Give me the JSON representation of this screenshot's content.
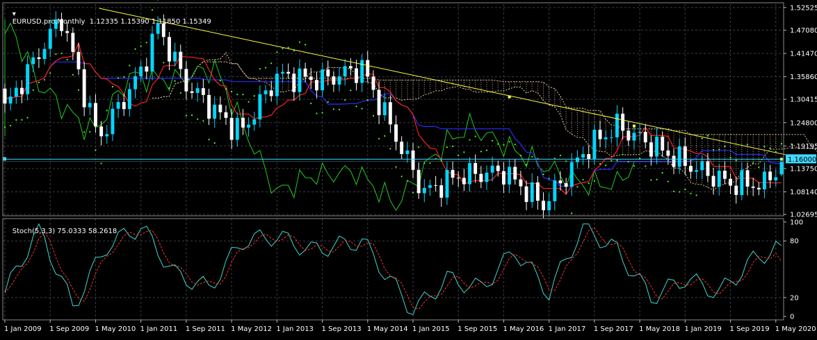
{
  "header": {
    "symbol_line": "EURUSD.pro,Monthly  1.12335 1.15390 1.11850 1.15349",
    "stoch_line": "Stoch(5,3,3) 75.0333 58.2618"
  },
  "colors": {
    "background": "#000000",
    "grid": "#3a3f46",
    "bull_candle": "#00d7ff",
    "bear_candle": "#ffffff",
    "tenkan": "#ff2020",
    "kijun": "#2b2bff",
    "chikou": "#22cc22",
    "cloud": "#e8c9a0",
    "sar": "#55ff22",
    "trendline": "#ffff40",
    "hline": "#40d8ff",
    "stoch_main": "#40d8d0",
    "stoch_signal": "#ff3030"
  },
  "chart_data": [
    {
      "type": "candlestick",
      "symbol": "EURUSD.pro",
      "timeframe": "Monthly",
      "ohlc_last": {
        "open": 1.12335,
        "high": 1.1539,
        "low": 1.1185,
        "close": 1.15349
      },
      "ylim": [
        1.027,
        1.53
      ],
      "y_ticks": [
        "1.52525",
        "1.47080",
        "1.41470",
        "1.35860",
        "1.30415",
        "1.24800",
        "1.19195",
        "1.13750",
        "1.08140",
        "1.02695"
      ],
      "x_ticks": [
        "1 Jan 2009",
        "1 Sep 2009",
        "1 May 2010",
        "1 Jan 2011",
        "1 Sep 2011",
        "1 May 2012",
        "1 Jan 2013",
        "1 Sep 2013",
        "1 May 2014",
        "1 Jan 2015",
        "1 Sep 2015",
        "1 May 2016",
        "1 Jan 2017",
        "1 Sep 2017",
        "1 May 2018",
        "1 Jan 2019",
        "1 Sep 2019",
        "1 May 2020"
      ],
      "price_label": "1.16000",
      "hline_price": 1.16,
      "trendline": {
        "points": [
          [
            "1 Jan 2011",
            1.51
          ],
          [
            "1 Jul 2020",
            1.17
          ]
        ],
        "anchors": [
          1.31,
          1.24
        ]
      },
      "anchor_labels": [
        "1.15349"
      ],
      "indicators": [
        "Ichimoku Tenkan-sen",
        "Ichimoku Kijun-sen",
        "Ichimoku Chikou Span",
        "Ichimoku Cloud",
        "Parabolic SAR"
      ],
      "key_closes": [
        [
          "1 Jan 2009",
          1.28
        ],
        [
          "1 Sep 2009",
          1.46
        ],
        [
          "1 Nov 2009",
          1.5
        ],
        [
          "1 May 2010",
          1.23
        ],
        [
          "1 Jun 2010",
          1.22
        ],
        [
          "1 Jan 2011",
          1.37
        ],
        [
          "1 Apr 2011",
          1.48
        ],
        [
          "1 Sep 2011",
          1.34
        ],
        [
          "1 May 2012",
          1.24
        ],
        [
          "1 Jul 2012",
          1.23
        ],
        [
          "1 Jan 2013",
          1.36
        ],
        [
          "1 Sep 2013",
          1.35
        ],
        [
          "1 Apr 2014",
          1.38
        ],
        [
          "1 Jan 2015",
          1.13
        ],
        [
          "1 Mar 2015",
          1.08
        ],
        [
          "1 Sep 2015",
          1.12
        ],
        [
          "1 May 2016",
          1.13
        ],
        [
          "1 Dec 2016",
          1.05
        ],
        [
          "1 Aug 2017",
          1.19
        ],
        [
          "1 Jan 2018",
          1.24
        ],
        [
          "1 Jan 2019",
          1.15
        ],
        [
          "1 Sep 2019",
          1.1
        ],
        [
          "1 Mar 2020",
          1.1
        ],
        [
          "1 Jun 2020",
          1.1535
        ]
      ]
    },
    {
      "type": "line",
      "title": "Stoch(5,3,3)",
      "ylim": [
        0,
        100
      ],
      "y_ticks": [
        "100",
        "80",
        "20",
        "0"
      ],
      "series": [
        {
          "name": "Main",
          "values": [
            75.0333
          ]
        },
        {
          "name": "Signal",
          "values": [
            58.2618
          ]
        }
      ],
      "key_main": [
        [
          "1 Jan 2009",
          25
        ],
        [
          "1 Jul 2009",
          95
        ],
        [
          "1 Jan 2010",
          10
        ],
        [
          "1 Jul 2010",
          75
        ],
        [
          "1 Jan 2011",
          95
        ],
        [
          "1 Jul 2011",
          45
        ],
        [
          "1 Jan 2012",
          30
        ],
        [
          "1 Jul 2012",
          80
        ],
        [
          "1 Jan 2013",
          85
        ],
        [
          "1 Jul 2013",
          70
        ],
        [
          "1 Apr 2014",
          80
        ],
        [
          "1 Jan 2015",
          5
        ],
        [
          "1 Jul 2015",
          40
        ],
        [
          "1 Jan 2016",
          30
        ],
        [
          "1 Jul 2016",
          70
        ],
        [
          "1 Jan 2017",
          25
        ],
        [
          "1 Jul 2017",
          95
        ],
        [
          "1 Jan 2018",
          70
        ],
        [
          "1 Jul 2018",
          20
        ],
        [
          "1 Jan 2019",
          40
        ],
        [
          "1 Jul 2019",
          25
        ],
        [
          "1 Jan 2020",
          60
        ],
        [
          "1 Jun 2020",
          75
        ]
      ]
    }
  ]
}
